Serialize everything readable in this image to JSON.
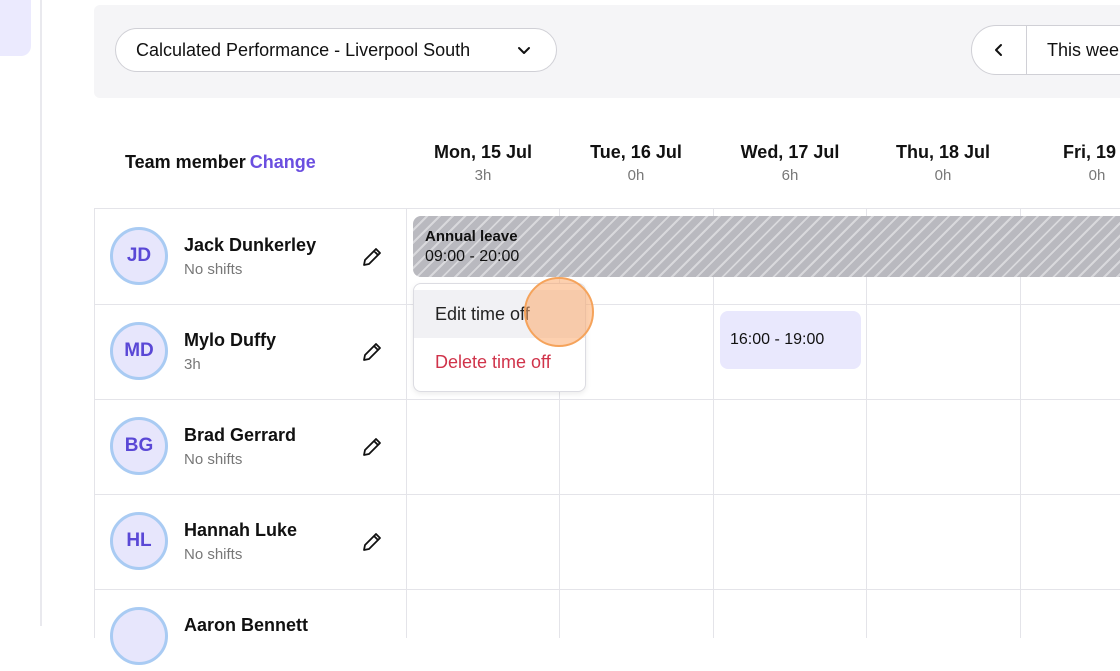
{
  "toolbar": {
    "location": "Calculated Performance - Liverpool South",
    "week_label": "This wee"
  },
  "header": {
    "team_label": "Team member",
    "change_label": "Change",
    "days": [
      {
        "name": "Mon, 15 Jul",
        "hours": "3h"
      },
      {
        "name": "Tue, 16 Jul",
        "hours": "0h"
      },
      {
        "name": "Wed, 17 Jul",
        "hours": "6h"
      },
      {
        "name": "Thu, 18 Jul",
        "hours": "0h"
      },
      {
        "name": "Fri, 19 J",
        "hours": "0h"
      }
    ]
  },
  "members": [
    {
      "initials": "JD",
      "name": "Jack Dunkerley",
      "sub": "No shifts"
    },
    {
      "initials": "MD",
      "name": "Mylo Duffy",
      "sub": "3h"
    },
    {
      "initials": "BG",
      "name": "Brad Gerrard",
      "sub": "No shifts"
    },
    {
      "initials": "HL",
      "name": "Hannah Luke",
      "sub": "No shifts"
    },
    {
      "initials": "",
      "name": "Aaron Bennett",
      "sub": ""
    }
  ],
  "time_off": {
    "title": "Annual leave",
    "time": "09:00 - 20:00"
  },
  "shift": {
    "time": "16:00 - 19:00"
  },
  "context_menu": {
    "edit": "Edit time off",
    "delete": "Delete time off"
  },
  "colors": {
    "accent": "#6b4fe0",
    "avatar_bg": "#e7e6fc",
    "avatar_ring": "#a9cbf3",
    "danger": "#d0334a",
    "shift_bg": "#e9e8fd",
    "leave_bg": "#b9b9bf",
    "cursor": "#f5a35b"
  },
  "icons": {
    "chevron": "chevron-down-icon",
    "prev": "chevron-left-icon",
    "edit": "pencil-icon"
  }
}
